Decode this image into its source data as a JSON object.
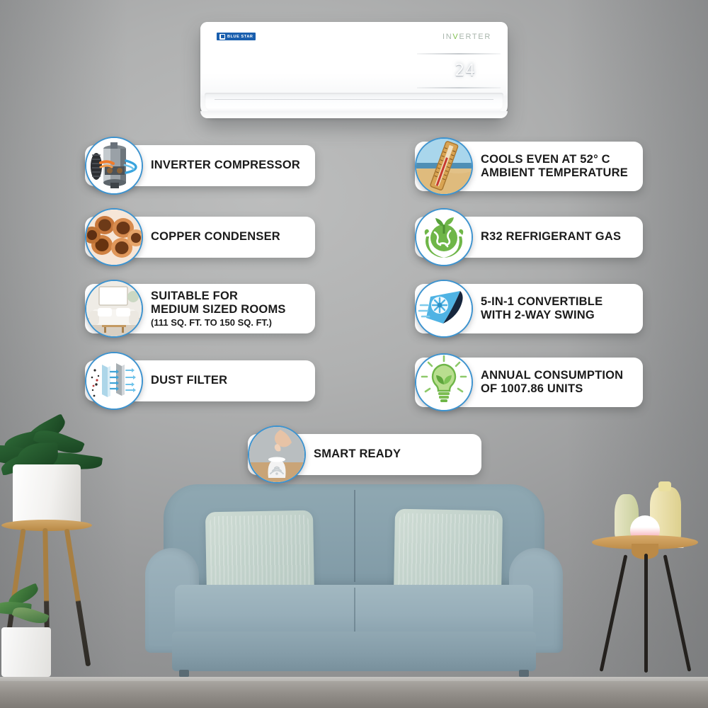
{
  "product": {
    "brand": "BLUE STAR",
    "inverter_label": "INVERTER",
    "display_temperature": "24"
  },
  "accent_colors": {
    "icon_ring": "#3d93cf",
    "card_bg": "#ffffff",
    "text": "#1b1b1b",
    "brand_blue": "#1a5fae",
    "inverter_green": "#7fbe4f"
  },
  "features": [
    {
      "id": "inverter-compressor",
      "icon": "compressor-icon",
      "lines": [
        "INVERTER COMPRESSOR"
      ]
    },
    {
      "id": "copper-condenser",
      "icon": "copper-pipes-icon",
      "lines": [
        "COPPER CONDENSER"
      ]
    },
    {
      "id": "suitable-for-medium-rooms",
      "icon": "living-room-icon",
      "lines": [
        "SUITABLE FOR",
        "MEDIUM SIZED ROOMS",
        "(111 SQ. FT. TO 150 SQ. FT.)"
      ]
    },
    {
      "id": "dust-filter",
      "icon": "air-filter-icon",
      "lines": [
        "DUST FILTER"
      ]
    },
    {
      "id": "cools-at-52c",
      "icon": "beach-thermometer-icon",
      "lines": [
        "COOLS EVEN AT 52° C",
        "AMBIENT TEMPERATURE"
      ]
    },
    {
      "id": "r32-refrigerant",
      "icon": "eco-globe-hands-icon",
      "lines": [
        "R32 REFRIGERANT GAS"
      ]
    },
    {
      "id": "5-in-1-convertible",
      "icon": "airflow-swing-icon",
      "lines": [
        " 5-IN-1 CONVERTIBLE",
        "WITH 2-WAY SWING"
      ]
    },
    {
      "id": "annual-consumption",
      "icon": "eco-bulb-icon",
      "lines": [
        "ANNUAL CONSUMPTION",
        "OF 1007.86 UNITS"
      ]
    },
    {
      "id": "smart-ready",
      "icon": "smart-speaker-icon",
      "lines": [
        "SMART READY"
      ]
    }
  ]
}
